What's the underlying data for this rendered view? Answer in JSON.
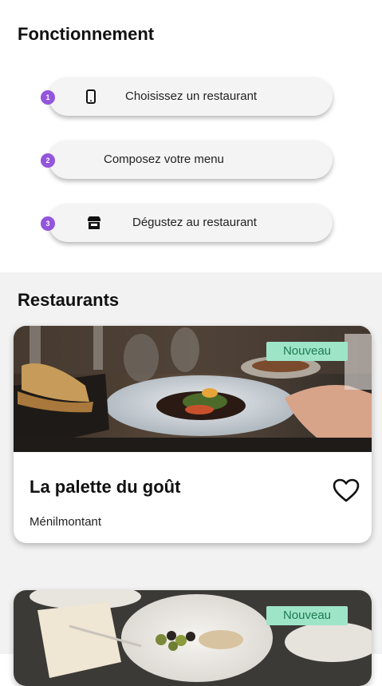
{
  "how": {
    "title": "Fonctionnement",
    "steps": [
      {
        "number": "1",
        "label": "Choisissez un restaurant",
        "icon": "smartphone-icon"
      },
      {
        "number": "2",
        "label": "Composez votre menu",
        "icon": ""
      },
      {
        "number": "3",
        "label": "Dégustez au restaurant",
        "icon": "store-icon"
      }
    ]
  },
  "restaurants": {
    "title": "Restaurants",
    "items": [
      {
        "badge": "Nouveau",
        "name": "La palette du goût",
        "location": "Ménilmontant",
        "favorite_icon": "heart-outline-icon"
      },
      {
        "badge": "Nouveau",
        "name": "",
        "location": ""
      }
    ]
  },
  "colors": {
    "accent": "#9355dc",
    "badge_bg": "#9ee5c8",
    "badge_text": "#1f7a50"
  }
}
